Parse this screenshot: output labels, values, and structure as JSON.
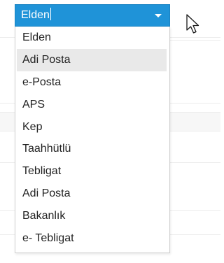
{
  "select": {
    "value": "Elden",
    "accent_color": "#1f93d8"
  },
  "dropdown": {
    "options": [
      {
        "label": "Elden"
      },
      {
        "label": "Adi Posta",
        "hovered": true
      },
      {
        "label": "e-Posta"
      },
      {
        "label": "APS"
      },
      {
        "label": "Kep"
      },
      {
        "label": "Taahhütlü"
      },
      {
        "label": "Tebligat"
      },
      {
        "label": "Adi Posta"
      },
      {
        "label": "Bakanlık"
      },
      {
        "label": "e- Tebligat"
      }
    ]
  },
  "icons": {
    "dropdown_arrow": "chevron-down-icon",
    "pointer": "mouse-pointer-icon"
  }
}
